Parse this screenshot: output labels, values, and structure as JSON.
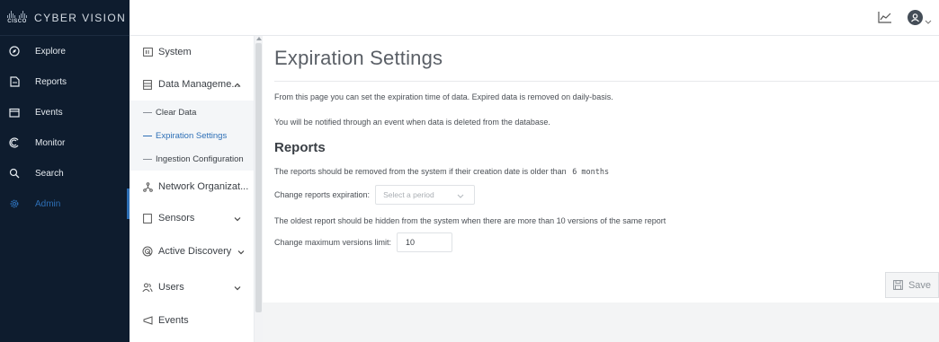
{
  "brand": {
    "logo_text": "CISCO",
    "product": "CYBER VISION"
  },
  "leftnav": {
    "items": [
      {
        "label": "Explore",
        "icon": "compass-icon"
      },
      {
        "label": "Reports",
        "icon": "report-icon"
      },
      {
        "label": "Events",
        "icon": "calendar-icon"
      },
      {
        "label": "Monitor",
        "icon": "monitor-icon"
      },
      {
        "label": "Search",
        "icon": "search-icon"
      },
      {
        "label": "Admin",
        "icon": "gear-icon",
        "active": true
      }
    ]
  },
  "header": {
    "icons": [
      "line-chart-icon",
      "user-avatar-icon",
      "chevron-down-icon"
    ]
  },
  "subnav": {
    "system": "System",
    "data_management": "Data Manageme...",
    "children": [
      "Clear Data",
      "Expiration Settings",
      "Ingestion Configuration"
    ],
    "network_org": "Network Organizat...",
    "sensors": "Sensors",
    "active_discovery": "Active Discovery",
    "users": "Users",
    "events": "Events"
  },
  "main": {
    "title": "Expiration Settings",
    "intro1": "From this page you can set the expiration time of data. Expired data is removed on daily-basis.",
    "intro2": "You will be notified through an event when data is deleted from the database.",
    "section": "Reports",
    "reports_text": "The reports should be removed from the system if their creation date is older than",
    "reports_value": "6 months",
    "change_expiration_label": "Change reports expiration:",
    "select_placeholder": "Select a period",
    "oldest_text": "The oldest report should be hidden from the system when there are more than 10 versions of the same report",
    "max_versions_label": "Change maximum versions limit:",
    "max_versions_value": "10",
    "save_label": "Save"
  },
  "colors": {
    "nav_bg": "#0e1c2e",
    "accent": "#2d6fb6"
  }
}
